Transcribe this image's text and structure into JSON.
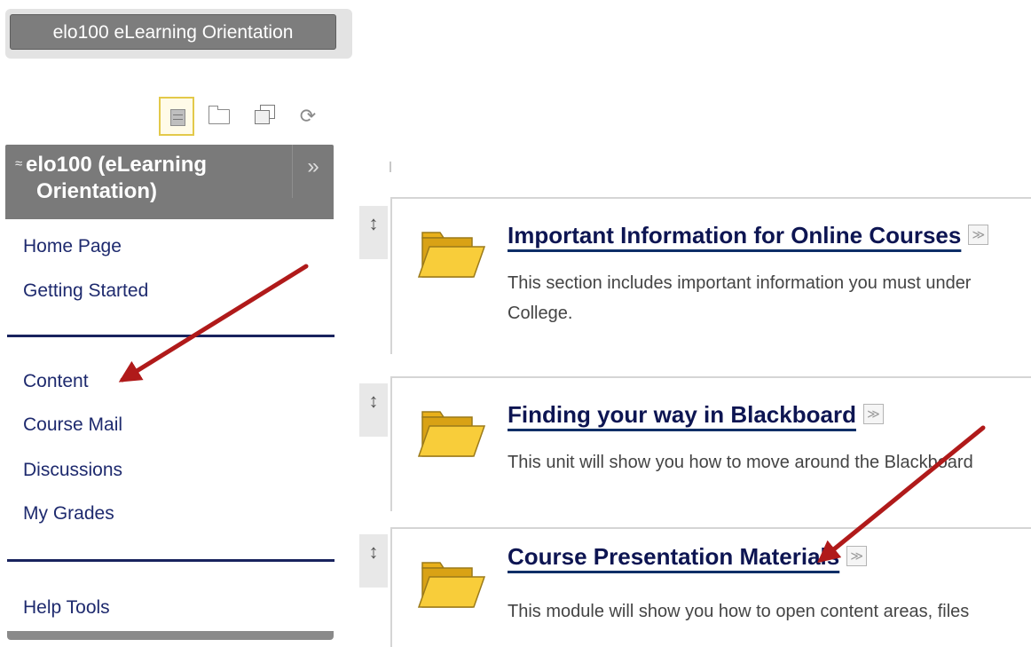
{
  "course_title_button": "elo100 eLearning Orientation",
  "view_icons": [
    "list-view-icon",
    "folder-view-icon",
    "window-icon",
    "refresh-icon"
  ],
  "course_menu": {
    "collapse_glyph": "≈",
    "name_line1": "elo100 (eLearning",
    "name_line2": "Orientation)",
    "expand_glyph": "»",
    "links": {
      "home_page": "Home Page",
      "getting_started": "Getting Started",
      "content": "Content",
      "course_mail": "Course Mail",
      "discussions": "Discussions",
      "my_grades": "My Grades",
      "help_tools": "Help Tools"
    }
  },
  "content_items": [
    {
      "title": "Important Information for Online Courses",
      "description_line1": "This section includes important information you must under",
      "description_line2": "College."
    },
    {
      "title": "Finding your way in Blackboard",
      "description_line1": "This unit will show you how to move around the Blackboard"
    },
    {
      "title": "Course Presentation Materials",
      "description_line1": "This module will show you how to open content areas, files"
    }
  ],
  "glyphs": {
    "drag_handle": "↕",
    "item_menu": "≫"
  },
  "colors": {
    "menu_header": "#7a7a7a",
    "link": "#1e2a6e",
    "divider": "#19235e",
    "annotation_arrow": "#b01a1a",
    "folder": "#f5c325"
  }
}
